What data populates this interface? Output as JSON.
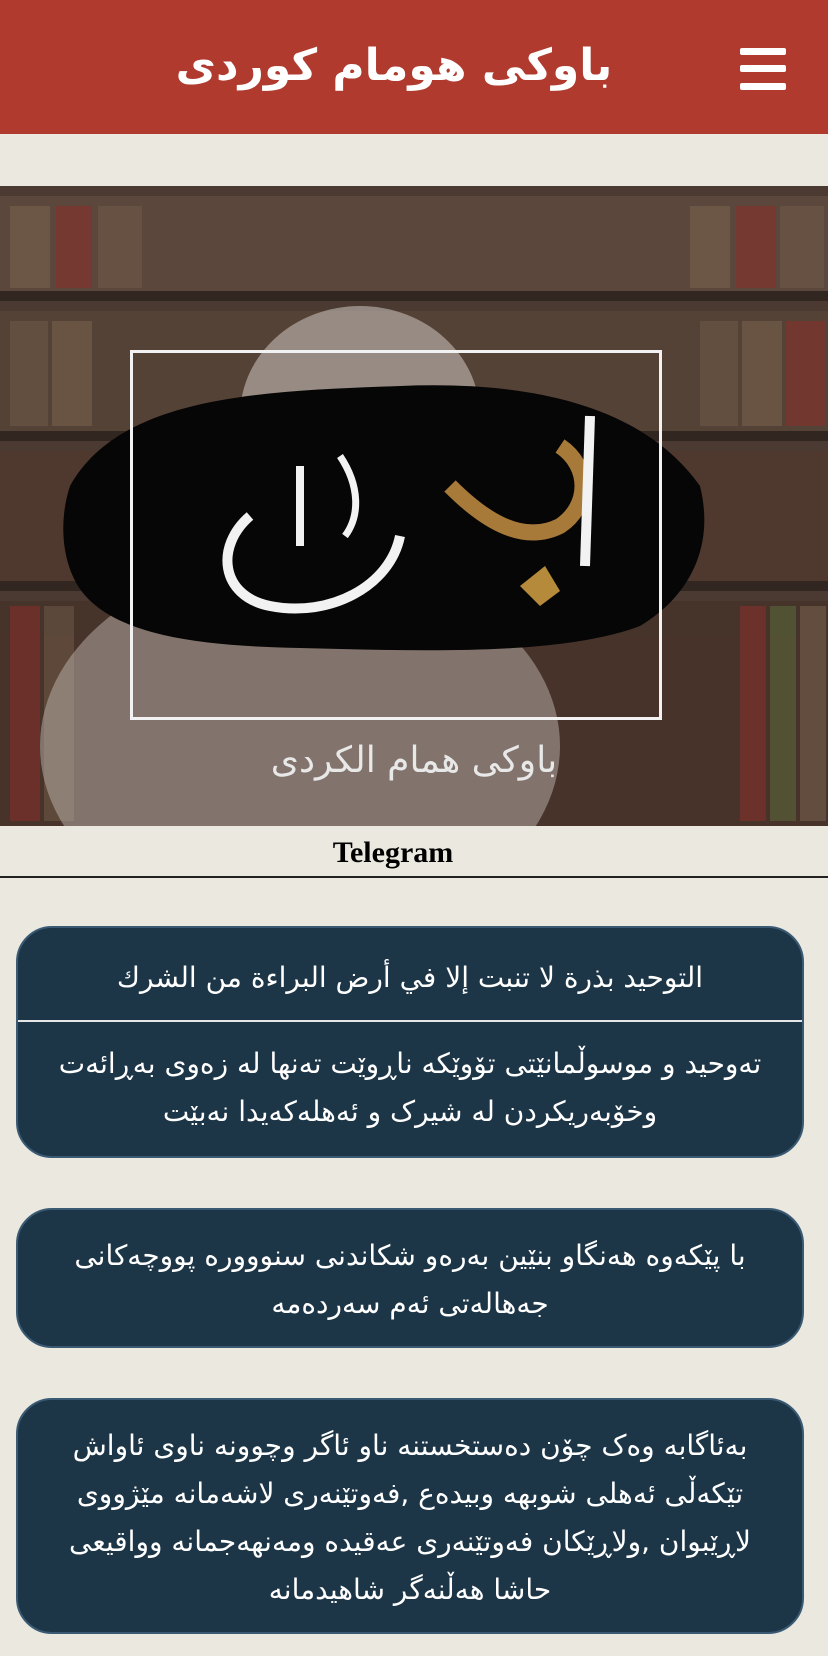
{
  "header": {
    "title": "باوکی هومام کوردی",
    "menu_icon": "hamburger-menu-icon",
    "background": "#b03a2e"
  },
  "banner": {
    "logo_text": "أبو همام",
    "caption": "باوکی همام الکردی"
  },
  "telegram": {
    "label": "Telegram"
  },
  "posts": [
    {
      "arabic": "التوحيد بذرة لا تنبت إلا في أرض البراءة من الشرك",
      "kurdish": "تەوحید و موسوڵمانێتی تۆوێکە ناڕوێت تەنها لە زەوی بەڕائەت وخۆبەریکردن لە شیرک و ئەهلەکەیدا نەبێت"
    },
    {
      "text": "با پێکەوە هەنگاو بنێین بەرەو شکاندنی سنووورە پووچەکانی جەهالەتی ئەم سەردەمە"
    },
    {
      "text": "بەئاگابە وەک چۆن دەستخستنە ناو ئاگر وچوونە ناوی ئاواش تێکەڵی ئەهلی شوبهە وبیدەع ,فەوتێنەری لاشەمانە مێژووی لاڕێبوان ,ولاڕێکان فەوتێنەری عەقیدە ومەنهەجمانە وواقیعی حاشا هەڵنەگر شاهیدمانە"
    }
  ],
  "colors": {
    "card_background": "#1c3547",
    "page_background": "#ebe8df"
  }
}
